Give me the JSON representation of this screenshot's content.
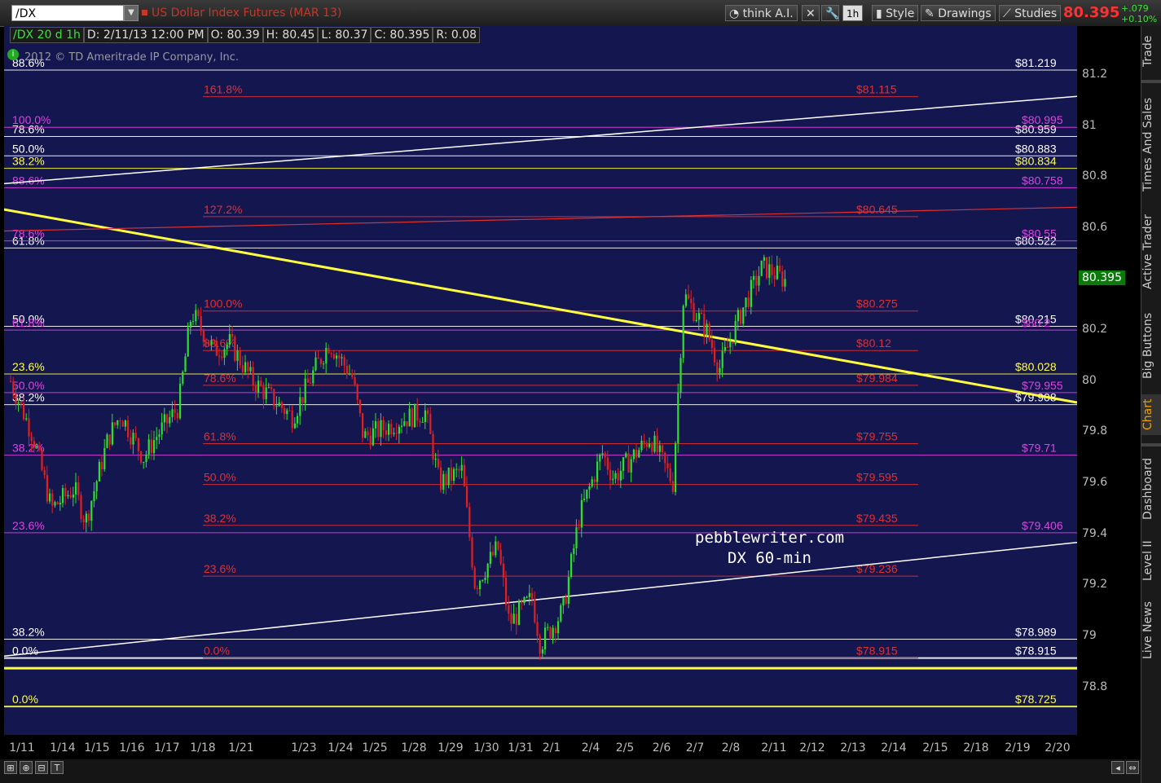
{
  "toolbar": {
    "symbol": "/DX",
    "description": "US Dollar Index Futures (MAR 13)",
    "buttons": [
      "think A.I.",
      "1h",
      "Style",
      "Drawings",
      "Studies"
    ],
    "last_price": "80.395",
    "change": "+.079",
    "change_pct": "+0.10%"
  },
  "info_bar": [
    "/DX 20 d 1h",
    "D: 2/11/13 12:00 PM",
    "O: 80.39",
    "H: 80.45",
    "L: 80.37",
    "C: 80.395",
    "R: 0.08"
  ],
  "copyright": "2012 © TD Ameritrade IP Company, Inc.",
  "watermark": [
    "pebblewriter.com",
    "DX 60-min"
  ],
  "current_price_tag": "80.395",
  "sidebar_tabs": [
    "Trade",
    "Times And Sales",
    "Active Trader",
    "Big Buttons",
    "Chart",
    "Dashboard",
    "Level II",
    "Live News"
  ],
  "bottom_buttons": [
    "⊞",
    "⊕",
    "⊟",
    "T"
  ],
  "colors": {
    "background": "#141650",
    "white_fib": "#ffffff",
    "red_fib": "#e03030",
    "magenta_fib": "#e040e0",
    "yellow_fib": "#ffff40",
    "trend_yellow": "#ffff40",
    "candle_up": "#2ee02e",
    "candle_down": "#e02020",
    "active_tab": "#f0a000"
  },
  "chart_data": {
    "type": "candlestick",
    "symbol": "/DX",
    "interval": "1h",
    "y_range": [
      78.68,
      81.42
    ],
    "y_ticks": [
      78.8,
      79,
      79.2,
      79.4,
      79.6,
      79.8,
      80,
      80.2,
      80.4,
      80.6,
      80.8,
      81,
      81.2
    ],
    "x_labels": [
      "1/11",
      "1/14",
      "1/15",
      "1/16",
      "1/17",
      "1/18",
      "1/21",
      "1/23",
      "1/24",
      "1/25",
      "1/28",
      "1/29",
      "1/30",
      "1/31",
      "2/1",
      "2/4",
      "2/5",
      "2/6",
      "2/7",
      "2/8",
      "2/11",
      "2/12",
      "2/13",
      "2/14",
      "2/15",
      "2/18",
      "2/19",
      "2/20"
    ],
    "price_path": [
      [
        "1/11",
        80.0
      ],
      [
        "1/11",
        79.78
      ],
      [
        "1/14",
        79.5
      ],
      [
        "1/14",
        79.58
      ],
      [
        "1/15",
        79.45
      ],
      [
        "1/15",
        79.78
      ],
      [
        "1/16",
        79.87
      ],
      [
        "1/16",
        79.7
      ],
      [
        "1/17",
        79.78
      ],
      [
        "1/17",
        79.9
      ],
      [
        "1/18",
        80.27
      ],
      [
        "1/18",
        80.12
      ],
      [
        "1/21",
        80.15
      ],
      [
        "1/21",
        80.0
      ],
      [
        "1/23",
        79.86
      ],
      [
        "1/23",
        80.05
      ],
      [
        "1/24",
        80.15
      ],
      [
        "1/24",
        80.02
      ],
      [
        "1/25",
        79.78
      ],
      [
        "1/25",
        79.82
      ],
      [
        "1/28",
        79.85
      ],
      [
        "1/28",
        79.88
      ],
      [
        "1/29",
        79.6
      ],
      [
        "1/29",
        79.65
      ],
      [
        "1/30",
        79.2
      ],
      [
        "1/30",
        79.35
      ],
      [
        "1/31",
        79.05
      ],
      [
        "1/31",
        79.15
      ],
      [
        "2/1",
        78.97
      ],
      [
        "2/1",
        79.1
      ],
      [
        "2/4",
        79.47
      ],
      [
        "2/4",
        79.72
      ],
      [
        "2/5",
        79.62
      ],
      [
        "2/5",
        79.72
      ],
      [
        "2/6",
        79.78
      ],
      [
        "2/6",
        79.6
      ],
      [
        "2/7",
        80.34
      ],
      [
        "2/7",
        80.2
      ],
      [
        "2/8",
        80.05
      ],
      [
        "2/8",
        80.28
      ],
      [
        "2/11",
        80.45
      ],
      [
        "2/11",
        80.395
      ]
    ],
    "candles": [
      {
        "date": "2/11/13 12:00",
        "open": 80.39,
        "high": 80.45,
        "low": 80.37,
        "close": 80.395
      }
    ],
    "fib_levels": [
      {
        "color": "white",
        "left_label": "88.6%",
        "right_label": "$81.219",
        "value": 81.219
      },
      {
        "color": "white",
        "left_label": "78.6%",
        "right_label": "$80.959",
        "value": 80.959
      },
      {
        "color": "white",
        "left_label": "50.0%",
        "right_label": "$80.883",
        "value": 80.883
      },
      {
        "color": "white",
        "left_label": "61.8%",
        "right_label": "$80.522",
        "value": 80.522
      },
      {
        "color": "white",
        "left_label": "50.0%",
        "right_label": "$80.215",
        "value": 80.215
      },
      {
        "color": "white",
        "left_label": "38.2%",
        "right_label": "$79.908",
        "value": 79.908
      },
      {
        "color": "white",
        "left_label": "38.2%",
        "right_label": "$78.989",
        "value": 78.989
      },
      {
        "color": "white",
        "left_label": "0.0%",
        "right_label": "$78.915",
        "value": 78.915
      },
      {
        "color": "yellow",
        "left_label": "38.2%",
        "right_label": "$80.834",
        "value": 80.834
      },
      {
        "color": "yellow",
        "left_label": "23.6%",
        "right_label": "$80.028",
        "value": 80.028
      },
      {
        "color": "yellow",
        "left_label": "0.0%",
        "right_label": "$78.725",
        "value": 78.725
      },
      {
        "color": "magenta",
        "left_label": "100.0%",
        "right_label": "$80.995",
        "value": 80.995
      },
      {
        "color": "magenta",
        "left_label": "88.6%",
        "right_label": "$80.758",
        "value": 80.758
      },
      {
        "color": "magenta",
        "left_label": "78.6%",
        "right_label": "$80.55",
        "value": 80.55
      },
      {
        "color": "magenta",
        "left_label": "61.8%",
        "right_label": "$80.2",
        "value": 80.2
      },
      {
        "color": "magenta",
        "left_label": "50.0%",
        "right_label": "$79.955",
        "value": 79.955
      },
      {
        "color": "magenta",
        "left_label": "38.2%",
        "right_label": "$79.71",
        "value": 79.71
      },
      {
        "color": "magenta",
        "left_label": "23.6%",
        "right_label": "$79.406",
        "value": 79.406
      },
      {
        "color": "red",
        "left_label": "161.8%",
        "right_label": "$81.115",
        "value": 81.115
      },
      {
        "color": "red",
        "left_label": "127.2%",
        "right_label": "$80.645",
        "value": 80.645
      },
      {
        "color": "red",
        "left_label": "100.0%",
        "right_label": "$80.275",
        "value": 80.275
      },
      {
        "color": "red",
        "left_label": "88.6%",
        "right_label": "$80.12",
        "value": 80.12
      },
      {
        "color": "red",
        "left_label": "78.6%",
        "right_label": "$79.984",
        "value": 79.984
      },
      {
        "color": "red",
        "left_label": "61.8%",
        "right_label": "$79.755",
        "value": 79.755
      },
      {
        "color": "red",
        "left_label": "50.0%",
        "right_label": "$79.595",
        "value": 79.595
      },
      {
        "color": "red",
        "left_label": "38.2%",
        "right_label": "$79.435",
        "value": 79.435
      },
      {
        "color": "red",
        "left_label": "23.6%",
        "right_label": "$79.236",
        "value": 79.236
      },
      {
        "color": "red",
        "left_label": "0.0%",
        "right_label": "$78.915",
        "value": 78.915
      }
    ],
    "trendlines": [
      {
        "color": "yellow",
        "from": [
          "1/11",
          80.66
        ],
        "to": [
          "2/20",
          79.93
        ]
      },
      {
        "color": "white",
        "from": [
          "1/11",
          78.93
        ],
        "to": [
          "2/20",
          79.36
        ]
      },
      {
        "color": "white",
        "from": [
          "1/11",
          80.78
        ],
        "to": [
          "2/20",
          81.11
        ]
      },
      {
        "color": "red",
        "from": [
          "1/11",
          80.59
        ],
        "to": [
          "2/20",
          80.68
        ]
      }
    ]
  }
}
